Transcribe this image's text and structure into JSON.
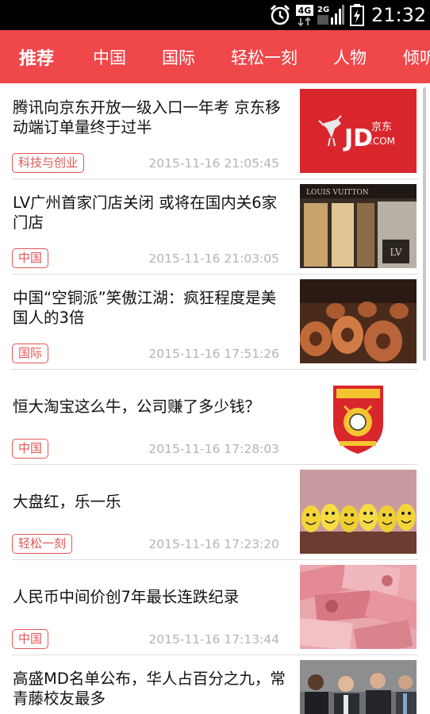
{
  "status_bar": {
    "time": "21:32",
    "network_top": "4G",
    "network_bottom": "2G",
    "icons": [
      "alarm-icon",
      "network-4g-icon",
      "signal-icon",
      "battery-charging-icon"
    ]
  },
  "nav": {
    "tabs": [
      {
        "label": "推荐",
        "active": true
      },
      {
        "label": "中国",
        "active": false
      },
      {
        "label": "国际",
        "active": false
      },
      {
        "label": "轻松一刻",
        "active": false
      },
      {
        "label": "人物",
        "active": false
      },
      {
        "label": "倾听",
        "active": false
      }
    ],
    "colors": {
      "background": "#f0474b",
      "text": "#ffffff"
    }
  },
  "news": [
    {
      "title": "腾讯向京东开放一级入口一年考 京东移动端订单量终于过半",
      "tag": "科技与创业",
      "time": "2015-11-16 21:05:45",
      "thumb": "jd-logo-image",
      "thumb_text_1": "JD",
      "thumb_text_2": "京东",
      "thumb_text_3": ".COM"
    },
    {
      "title": "LV广州首家门店关闭 或将在国内关6家门店",
      "tag": "中国",
      "time": "2015-11-16 21:03:05",
      "thumb": "louis-vuitton-store-image",
      "thumb_text_1": "LOUIS VUITTON"
    },
    {
      "title": "中国“空铜派”笑傲江湖：疯狂程度是美国人的3倍",
      "tag": "国际",
      "time": "2015-11-16 17:51:26",
      "thumb": "copper-coils-image"
    },
    {
      "title": "恒大淘宝这么牛，公司赚了多少钱？",
      "tag": "中国",
      "time": "2015-11-16 17:28:03",
      "thumb": "evergrande-crest-image"
    },
    {
      "title": "大盘红，乐一乐",
      "tag": "轻松一刻",
      "time": "2015-11-16 17:23:20",
      "thumb": "smiley-eggs-image"
    },
    {
      "title": "人民币中间价创7年最长连跌纪录",
      "tag": "中国",
      "time": "2015-11-16 17:13:44",
      "thumb": "rmb-banknotes-image"
    },
    {
      "title": "高盛MD名单公布，华人占百分之九，常青藤校友最多",
      "tag": "",
      "time": "",
      "thumb": "businessmen-photo-image"
    }
  ]
}
